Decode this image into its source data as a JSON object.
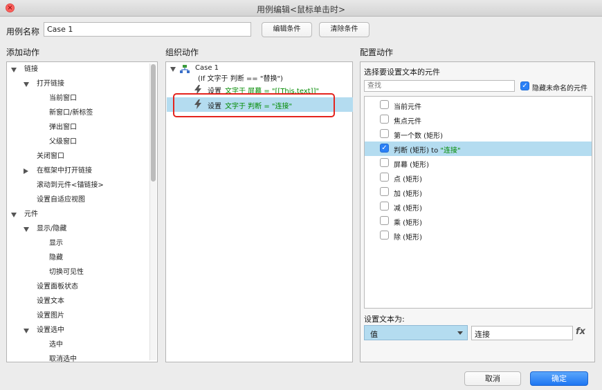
{
  "window": {
    "title": "用例编辑<鼠标单击时>",
    "close_glyph": "×"
  },
  "header": {
    "case_name_label": "用例名称",
    "case_name_value": "Case 1",
    "edit_condition_button": "编辑条件",
    "clear_condition_button": "清除条件"
  },
  "add_actions": {
    "heading": "添加动作",
    "items": [
      {
        "label": "链接",
        "expander": "down"
      },
      {
        "label": "打开链接",
        "expander": "down"
      },
      {
        "label": "当前窗口",
        "expander": ""
      },
      {
        "label": "新窗口/新标签",
        "expander": ""
      },
      {
        "label": "弹出窗口",
        "expander": ""
      },
      {
        "label": "父级窗口",
        "expander": ""
      },
      {
        "label": "关闭窗口",
        "expander": ""
      },
      {
        "label": "在框架中打开链接",
        "expander": "right"
      },
      {
        "label": "滚动到元件<锚链接>",
        "expander": ""
      },
      {
        "label": "设置自适应视图",
        "expander": ""
      },
      {
        "label": "元件",
        "expander": "down"
      },
      {
        "label": "显示/隐藏",
        "expander": "down"
      },
      {
        "label": "显示",
        "expander": ""
      },
      {
        "label": "隐藏",
        "expander": ""
      },
      {
        "label": "切换可见性",
        "expander": ""
      },
      {
        "label": "设置面板状态",
        "expander": ""
      },
      {
        "label": "设置文本",
        "expander": ""
      },
      {
        "label": "设置图片",
        "expander": ""
      },
      {
        "label": "设置选中",
        "expander": "down"
      },
      {
        "label": "选中",
        "expander": ""
      },
      {
        "label": "取消选中",
        "expander": ""
      }
    ]
  },
  "organize_actions": {
    "heading": "组织动作",
    "case_label": "Case 1",
    "condition": "(If 文字于 判断 == \"替换\")",
    "actions": [
      {
        "prefix": "设置 ",
        "detail": "文字于 屏幕 = \"[[This.text]]\""
      },
      {
        "prefix": "设置 ",
        "detail": "文字于 判断 = \"连接\""
      }
    ]
  },
  "configure_actions": {
    "heading": "配置动作",
    "select_widget_label": "选择要设置文本的元件",
    "search_placeholder": "查找",
    "hide_unnamed_label": "隐藏未命名的元件",
    "hide_unnamed_checked": true,
    "widgets": [
      {
        "label": "当前元件",
        "suffix": "",
        "checked": false
      },
      {
        "label": "焦点元件",
        "suffix": "",
        "checked": false
      },
      {
        "label": "第一个数 (矩形)",
        "suffix": "",
        "checked": false
      },
      {
        "label": "判断 (矩形) to ",
        "suffix": "\"连接\"",
        "checked": true
      },
      {
        "label": "屏幕 (矩形)",
        "suffix": "",
        "checked": false
      },
      {
        "label": "点 (矩形)",
        "suffix": "",
        "checked": false
      },
      {
        "label": "加 (矩形)",
        "suffix": "",
        "checked": false
      },
      {
        "label": "减 (矩形)",
        "suffix": "",
        "checked": false
      },
      {
        "label": "乘 (矩形)",
        "suffix": "",
        "checked": false
      },
      {
        "label": "除 (矩形)",
        "suffix": "",
        "checked": false
      }
    ],
    "set_text_label": "设置文本为:",
    "value_type": "值",
    "value_text": "连接",
    "fx_label": "fx"
  },
  "footer": {
    "cancel_button": "取消",
    "ok_button": "确定"
  },
  "colors": {
    "selection": "#b4dcf0",
    "accent": "#2a80f6",
    "green_text": "#008a00",
    "highlight_box": "#e4231d"
  }
}
